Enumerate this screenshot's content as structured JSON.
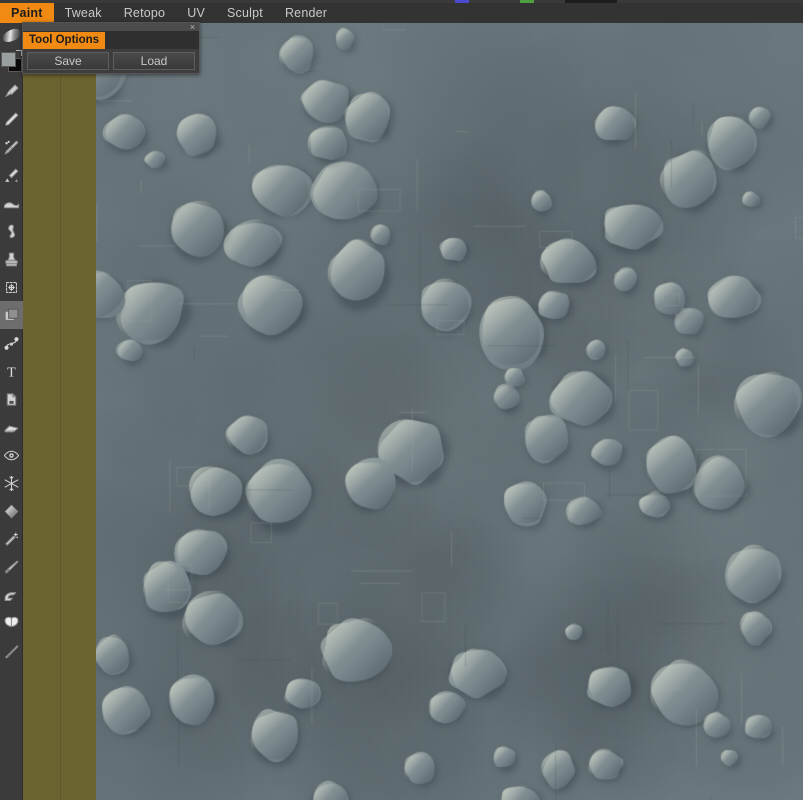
{
  "app": {
    "title": "3D Paint Application",
    "accent_color": "#f08a12",
    "chrome_color": "#333333",
    "toolbar_color": "#3b3b3b",
    "viewport_color": "#6c7a80",
    "model_band_color": "#6b6330"
  },
  "menubar": {
    "items": [
      {
        "label": "Paint",
        "active": true
      },
      {
        "label": "Tweak",
        "active": false
      },
      {
        "label": "Retopo",
        "active": false
      },
      {
        "label": "UV",
        "active": false
      },
      {
        "label": "Sculpt",
        "active": false
      },
      {
        "label": "Render",
        "active": false
      }
    ]
  },
  "tool_options_panel": {
    "title": "Tool  Options",
    "close_label": "×",
    "buttons": [
      {
        "label": "Save"
      },
      {
        "label": "Load"
      }
    ]
  },
  "toolbar": {
    "brush_preview_name": "brush-stroke-preview",
    "color_swatch": {
      "foreground": "#9aa0a0",
      "background": "#0b0b0b",
      "swap_name": "swap-colors-icon"
    },
    "tools": [
      {
        "icon": "paintbrush-icon",
        "name": "paint-brush-tool",
        "selected": false
      },
      {
        "icon": "pencil-icon",
        "name": "pencil-tool",
        "selected": false
      },
      {
        "icon": "airbrush-icon",
        "name": "airbrush-tool",
        "selected": false
      },
      {
        "icon": "brush-soft-icon",
        "name": "soft-brush-tool",
        "selected": false
      },
      {
        "icon": "smudge-icon",
        "name": "smudge-tool",
        "selected": false
      },
      {
        "icon": "blob-brush-icon",
        "name": "blob-brush-tool",
        "selected": false
      },
      {
        "icon": "stamp-icon",
        "name": "stamp-tool",
        "selected": false
      },
      {
        "icon": "transform-icon",
        "name": "transform-tool",
        "selected": false
      },
      {
        "icon": "layers-icon",
        "name": "layers-tool",
        "selected": true
      },
      {
        "icon": "curve-node-icon",
        "name": "curve-tool",
        "selected": false
      },
      {
        "icon": "text-icon",
        "name": "text-tool",
        "selected": false
      },
      {
        "icon": "page-icon",
        "name": "projection-tool",
        "selected": false
      },
      {
        "icon": "eraser-icon",
        "name": "eraser-tool",
        "selected": false
      },
      {
        "icon": "eye-icon",
        "name": "visibility-tool",
        "selected": false
      },
      {
        "icon": "snowflake-icon",
        "name": "freeze-tool",
        "selected": false
      },
      {
        "icon": "gradient-icon",
        "name": "gradient-tool",
        "selected": false
      },
      {
        "icon": "magic-wand-icon",
        "name": "magic-wand-tool",
        "selected": false
      },
      {
        "icon": "knife-icon",
        "name": "knife-tool",
        "selected": false
      },
      {
        "icon": "clone-icon",
        "name": "clone-tool",
        "selected": false
      },
      {
        "icon": "butterfly-icon",
        "name": "symmetry-tool",
        "selected": false
      },
      {
        "icon": "ruler-icon",
        "name": "measure-tool",
        "selected": false
      }
    ]
  },
  "viewport": {
    "name": "3d-model-viewport",
    "material": "pebble-cobblestone-relief",
    "base_color": "#6c7a80",
    "highlight_color": "#9aa59f",
    "shadow_color": "#55636a"
  }
}
